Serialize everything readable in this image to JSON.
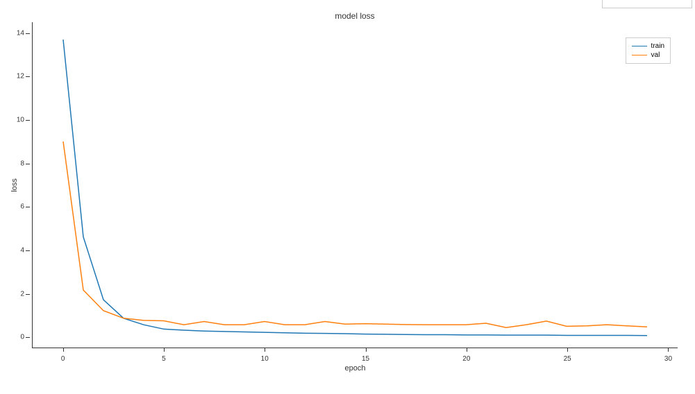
{
  "chart_data": {
    "type": "line",
    "title": "model loss",
    "xlabel": "epoch",
    "ylabel": "loss",
    "xlim": [
      -1.5,
      30.5
    ],
    "ylim": [
      -0.5,
      14.5
    ],
    "x_ticks": [
      0,
      5,
      10,
      15,
      20,
      25,
      30
    ],
    "y_ticks": [
      0,
      2,
      4,
      6,
      8,
      10,
      12,
      14
    ],
    "x": [
      0,
      1,
      2,
      3,
      4,
      5,
      6,
      7,
      8,
      9,
      10,
      11,
      12,
      13,
      14,
      15,
      16,
      17,
      18,
      19,
      20,
      21,
      22,
      23,
      24,
      25,
      26,
      27,
      28,
      29
    ],
    "series": [
      {
        "name": "train",
        "color": "#1f77b4",
        "values": [
          13.7,
          4.6,
          1.7,
          0.85,
          0.55,
          0.35,
          0.3,
          0.26,
          0.24,
          0.22,
          0.2,
          0.18,
          0.16,
          0.15,
          0.14,
          0.12,
          0.11,
          0.1,
          0.09,
          0.09,
          0.08,
          0.08,
          0.07,
          0.07,
          0.07,
          0.06,
          0.06,
          0.06,
          0.06,
          0.05
        ]
      },
      {
        "name": "val",
        "color": "#ff7f0e",
        "values": [
          9.0,
          2.15,
          1.2,
          0.85,
          0.75,
          0.73,
          0.55,
          0.7,
          0.55,
          0.55,
          0.7,
          0.55,
          0.55,
          0.7,
          0.58,
          0.6,
          0.58,
          0.56,
          0.55,
          0.55,
          0.55,
          0.62,
          0.42,
          0.55,
          0.72,
          0.48,
          0.5,
          0.55,
          0.5,
          0.45
        ]
      }
    ]
  },
  "legend": {
    "items": [
      {
        "label": "train",
        "color": "#1f77b4"
      },
      {
        "label": "val",
        "color": "#ff7f0e"
      }
    ]
  }
}
